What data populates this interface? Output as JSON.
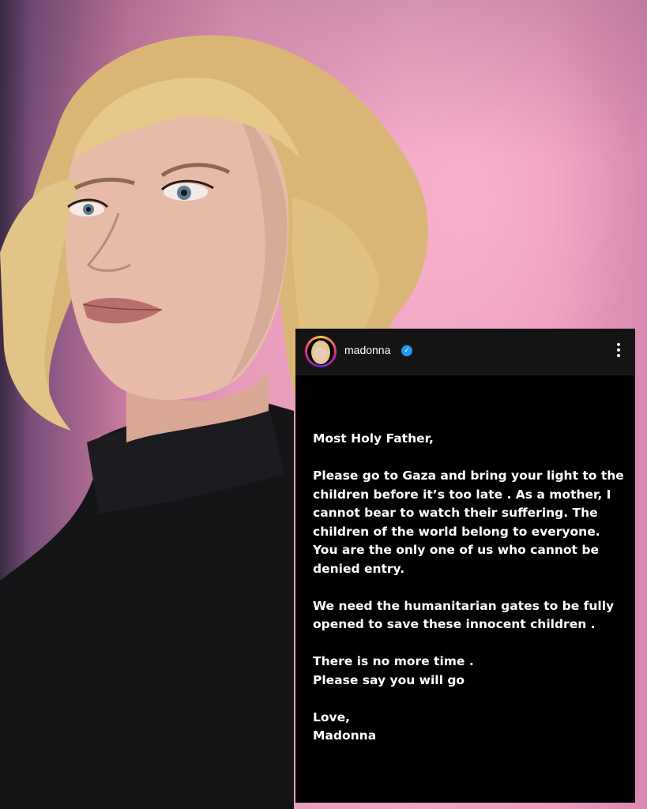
{
  "post": {
    "username": "madonna",
    "verified": true,
    "more_icon": "more-vertical-icon"
  },
  "letter": {
    "salutation": "Most Holy Father,",
    "paragraph1": "Please go to Gaza and bring your light to the children before it’s too late .  As a mother, I cannot bear to watch their suffering.  The children of the world belong to everyone.",
    "paragraph1b": "You are the only one  of us who cannot be denied entry.",
    "paragraph2": "We need the humanitarian gates to be  fully  opened to save these innocent children .",
    "paragraph3a": "There is no more time .",
    "paragraph3b": "Please say you will go",
    "closing": "Love,",
    "signature": "Madonna"
  },
  "colors": {
    "background_pink": "#f0a6c4",
    "card_bg": "#000000",
    "header_bg": "#141414",
    "verified_blue": "#1d9bf0"
  }
}
